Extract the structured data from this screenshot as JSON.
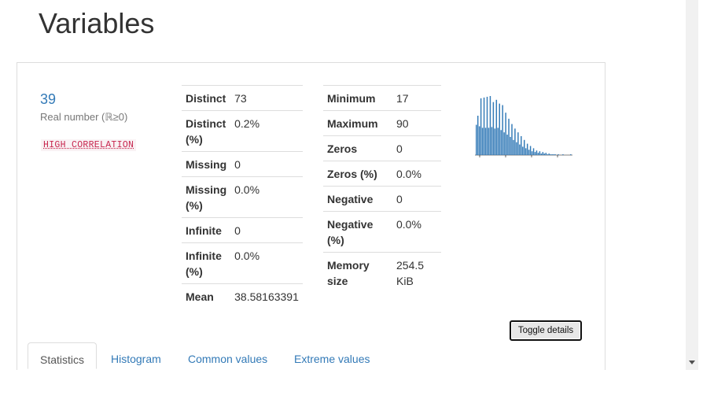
{
  "page": {
    "title": "Variables"
  },
  "variable": {
    "name": "39",
    "type": "Real number (ℝ≥0)",
    "alert": "HIGH CORRELATION"
  },
  "stats_left": [
    {
      "key": "Distinct",
      "value": "73"
    },
    {
      "key": "Distinct (%)",
      "value": "0.2%"
    },
    {
      "key": "Missing",
      "value": "0"
    },
    {
      "key": "Missing (%)",
      "value": "0.0%"
    },
    {
      "key": "Infinite",
      "value": "0"
    },
    {
      "key": "Infinite (%)",
      "value": "0.0%"
    },
    {
      "key": "Mean",
      "value": "38.58163391"
    }
  ],
  "stats_right": [
    {
      "key": "Minimum",
      "value": "17"
    },
    {
      "key": "Maximum",
      "value": "90"
    },
    {
      "key": "Zeros",
      "value": "0"
    },
    {
      "key": "Zeros (%)",
      "value": "0.0%"
    },
    {
      "key": "Negative",
      "value": "0"
    },
    {
      "key": "Negative (%)",
      "value": "0.0%"
    },
    {
      "key": "Memory size",
      "value": "254.5 KiB"
    }
  ],
  "chart_data": {
    "type": "bar",
    "title": "",
    "xlabel": "",
    "ylabel": "",
    "color": "#337ab7",
    "values": [
      40,
      52,
      38,
      75,
      36,
      76,
      36,
      77,
      36,
      78,
      37,
      70,
      35,
      73,
      36,
      68,
      33,
      66,
      30,
      56,
      27,
      48,
      24,
      41,
      20,
      35,
      17,
      30,
      14,
      25,
      11,
      20,
      9,
      15,
      7,
      12,
      5,
      9,
      4,
      6,
      3,
      5,
      2,
      4,
      2,
      3,
      1,
      2,
      1,
      1,
      1,
      1,
      0,
      1,
      0,
      0,
      1,
      0,
      0,
      0,
      0,
      1
    ]
  },
  "toggle_label": "Toggle details",
  "tabs": [
    {
      "label": "Statistics",
      "active": true
    },
    {
      "label": "Histogram",
      "active": false
    },
    {
      "label": "Common values",
      "active": false
    },
    {
      "label": "Extreme values",
      "active": false
    }
  ]
}
